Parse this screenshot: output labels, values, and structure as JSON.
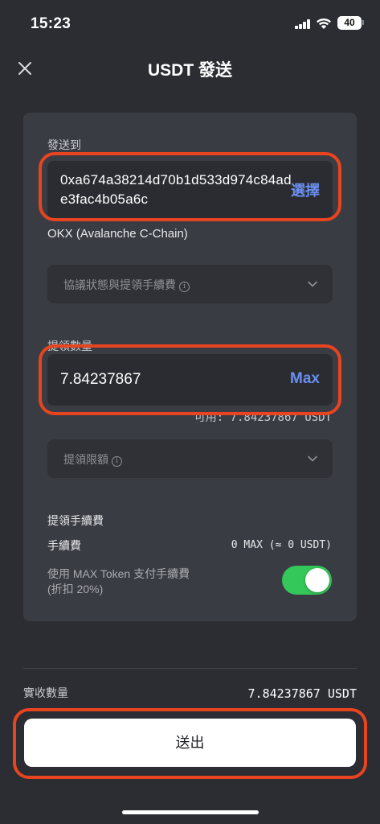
{
  "status_bar": {
    "time": "15:23",
    "battery": "40"
  },
  "header": {
    "title": "USDT 發送"
  },
  "send_to": {
    "label": "發送到",
    "address": "0xa674a38214d70b1d533d974c84ade3fac4b05a6c",
    "select_label": "選擇",
    "network": "OKX (Avalanche C-Chain)"
  },
  "protocol_dropdown": {
    "label": "協議狀態與提領手續費"
  },
  "amount": {
    "label": "提領數量",
    "value": "7.84237867",
    "max_label": "Max",
    "available": "可用: 7.84237867 USDT"
  },
  "limit_dropdown": {
    "label": "提領限額"
  },
  "fee": {
    "title": "提領手續費",
    "fee_label": "手續費",
    "fee_value": "0 MAX (≈ 0 USDT)",
    "token_fee_label": "使用 MAX Token 支付手續費\n(折扣 20%)",
    "token_fee_enabled": true
  },
  "summary": {
    "received_label": "實收數量",
    "received_value": "7.84237867 USDT"
  },
  "submit": {
    "label": "送出"
  },
  "colors": {
    "accent": "#6b8ff0",
    "toggle_on": "#34c759",
    "highlight": "#e8441f"
  }
}
